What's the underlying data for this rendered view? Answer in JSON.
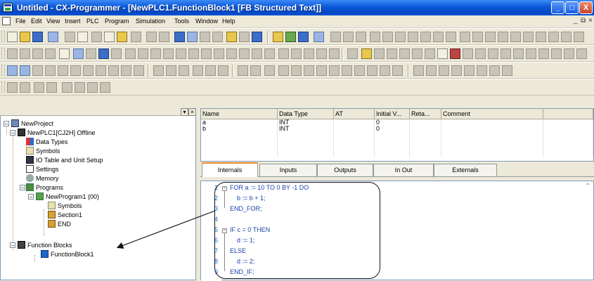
{
  "window": {
    "title": "Untitled - CX-Programmer - [NewPLC1.FunctionBlock1 [FB Structured Text]]",
    "min": "_",
    "max": "□",
    "close": "X"
  },
  "menu": {
    "items": [
      "File",
      "Edit",
      "View",
      "Insert",
      "PLC",
      "Program",
      "Simulation",
      "Tools",
      "Window",
      "Help"
    ],
    "mdi_min": "_",
    "mdi_restore": "⧉",
    "mdi_close": "×"
  },
  "project_tree": {
    "items": [
      "NewProject",
      "NewPLC1[CJ2H] Offline",
      "Data Types",
      "Symbols",
      "IO Table and Unit Setup",
      "Settings",
      "Memory",
      "Programs",
      "NewProgram1 (00)",
      "Symbols",
      "Section1",
      "END",
      "Function Blocks",
      "FunctionBlock1"
    ]
  },
  "variables": {
    "columns": [
      "Name",
      "Data Type",
      "AT",
      "Initial V...",
      "Reta...",
      "Comment"
    ],
    "rows": [
      [
        "a",
        "INT",
        "",
        "0",
        "",
        ""
      ],
      [
        "b",
        "INT",
        "",
        "0",
        "",
        ""
      ]
    ]
  },
  "tabs": [
    "Internals",
    "Inputs",
    "Outputs",
    "In Out",
    "Externals"
  ],
  "active_tab": "Internals",
  "code": {
    "line_numbers": [
      "1",
      "2",
      "3",
      "4",
      "5",
      "6",
      "7",
      "8",
      "9"
    ],
    "lines": [
      "FOR a := 10 TO 0 BY -1 DO",
      "    b := b + 1;",
      "END_FOR;",
      "",
      "IF c = 0 THEN",
      "    d := 1;",
      "ELSE",
      "    d := 2;",
      "END_IF;"
    ]
  },
  "colors": {
    "titlebar": "#0a58d8",
    "code_text": "#1b42a8",
    "line_numbers": "#1b6ad4",
    "active_tab_accent": "#e68b2c"
  }
}
